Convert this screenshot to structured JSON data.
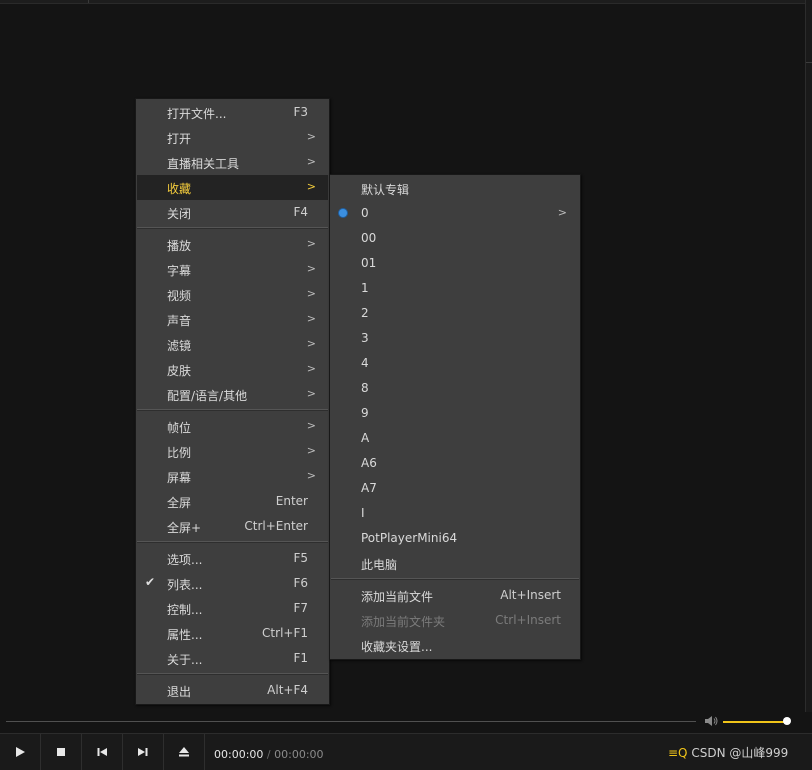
{
  "main_menu": {
    "items": [
      {
        "label": "打开文件...",
        "shortcut": "F3",
        "submenu": false
      },
      {
        "label": "打开",
        "shortcut": "",
        "submenu": true
      },
      {
        "label": "直播相关工具",
        "shortcut": "",
        "submenu": true
      },
      {
        "label": "收藏",
        "shortcut": "",
        "submenu": true,
        "highlighted": true
      },
      {
        "label": "关闭",
        "shortcut": "F4",
        "submenu": false
      },
      {
        "label": "播放",
        "shortcut": "",
        "submenu": true
      },
      {
        "label": "字幕",
        "shortcut": "",
        "submenu": true
      },
      {
        "label": "视频",
        "shortcut": "",
        "submenu": true
      },
      {
        "label": "声音",
        "shortcut": "",
        "submenu": true
      },
      {
        "label": "滤镜",
        "shortcut": "",
        "submenu": true
      },
      {
        "label": "皮肤",
        "shortcut": "",
        "submenu": true
      },
      {
        "label": "配置/语言/其他",
        "shortcut": "",
        "submenu": true
      },
      {
        "label": "帧位",
        "shortcut": "",
        "submenu": true
      },
      {
        "label": "比例",
        "shortcut": "",
        "submenu": true
      },
      {
        "label": "屏幕",
        "shortcut": "",
        "submenu": true
      },
      {
        "label": "全屏",
        "shortcut": "Enter",
        "submenu": false
      },
      {
        "label": "全屏+",
        "shortcut": "Ctrl+Enter",
        "submenu": false
      },
      {
        "label": "选项...",
        "shortcut": "F5",
        "submenu": false
      },
      {
        "label": "列表...",
        "shortcut": "F6",
        "submenu": false,
        "checked": true
      },
      {
        "label": "控制...",
        "shortcut": "F7",
        "submenu": false
      },
      {
        "label": "属性...",
        "shortcut": "Ctrl+F1",
        "submenu": false
      },
      {
        "label": "关于...",
        "shortcut": "F1",
        "submenu": false
      },
      {
        "label": "退出",
        "shortcut": "Alt+F4",
        "submenu": false
      }
    ],
    "arrow_glyph": ">"
  },
  "favorites_menu": {
    "items": [
      {
        "label": "默认专辑"
      },
      {
        "label": "0",
        "selected": true,
        "submenu": true
      },
      {
        "label": "00"
      },
      {
        "label": "01"
      },
      {
        "label": "1"
      },
      {
        "label": "2"
      },
      {
        "label": "3"
      },
      {
        "label": "4"
      },
      {
        "label": "8"
      },
      {
        "label": "9"
      },
      {
        "label": "A"
      },
      {
        "label": "A6"
      },
      {
        "label": "A7"
      },
      {
        "label": "I"
      },
      {
        "label": "PotPlayerMini64"
      },
      {
        "label": "此电脑"
      },
      {
        "label": "添加当前文件",
        "shortcut": "Alt+Insert"
      },
      {
        "label": "添加当前文件夹",
        "shortcut": "Ctrl+Insert",
        "disabled": true
      },
      {
        "label": "收藏夹设置..."
      }
    ]
  },
  "player": {
    "time_current": "00:00:00",
    "time_separator": "/",
    "time_total": "00:00:00",
    "volume_level": 1.0,
    "buttons": [
      "play-icon",
      "stop-icon",
      "previous-icon",
      "next-icon",
      "eject-icon"
    ],
    "watermark": "CSDN @山峰999"
  },
  "colors": {
    "highlight_text": "#f5cd3c",
    "accent_radio": "#3b8fe0",
    "volume": "#f0c419",
    "menu_bg": "#3e3e3e"
  }
}
